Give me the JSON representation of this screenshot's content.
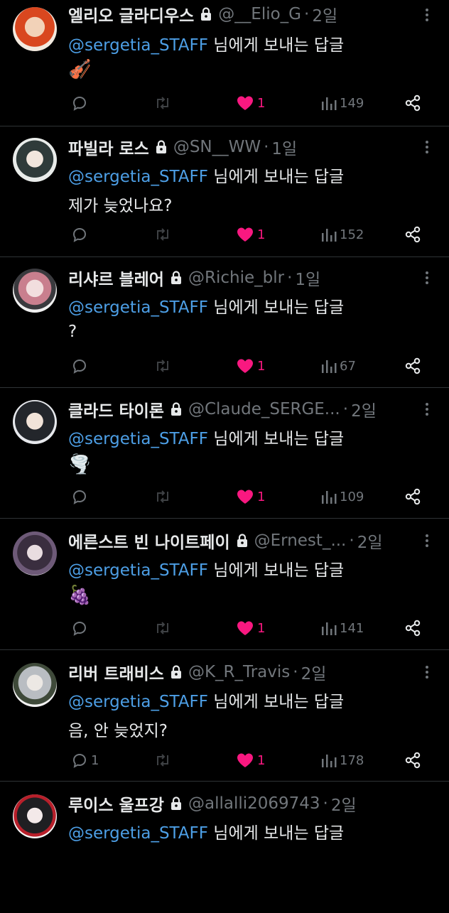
{
  "reply_to_prefix": "@sergetia_STAFF",
  "reply_to_suffix": " 님에게 보내는 답글",
  "colors": {
    "background": "#000000",
    "mention": "#4d9fe6",
    "like": "#f91880",
    "muted": "#71767b"
  },
  "tweets": [
    {
      "name": "엘리오 글라디우스",
      "handle": "@__Elio_G",
      "time": "2일",
      "body": "🎻",
      "replies": "",
      "likes": "1",
      "views": "149"
    },
    {
      "name": "파빌라 로스",
      "handle": "@SN__WW",
      "time": "1일",
      "body": "제가 늦었나요?",
      "replies": "",
      "likes": "1",
      "views": "152"
    },
    {
      "name": "리샤르 블레어",
      "handle": "@Richie_blr",
      "time": "1일",
      "body": "?",
      "replies": "",
      "likes": "1",
      "views": "67"
    },
    {
      "name": "클라드 타이론",
      "handle": "@Claude_SERGE...",
      "time": "2일",
      "body": "🌪️",
      "replies": "",
      "likes": "1",
      "views": "109"
    },
    {
      "name": "에른스트 빈 나이트페이",
      "handle": "@Ernest_...",
      "time": "2일",
      "body": "🍇",
      "replies": "",
      "likes": "1",
      "views": "141"
    },
    {
      "name": "리버 트래비스",
      "handle": "@K_R_Travis",
      "time": "2일",
      "body": "음, 안 늦었지?",
      "replies": "1",
      "likes": "1",
      "views": "178"
    },
    {
      "name": "루이스 울프강",
      "handle": "@allalli2069743",
      "time": "2일",
      "body": "",
      "replies": "",
      "likes": "",
      "views": ""
    }
  ]
}
